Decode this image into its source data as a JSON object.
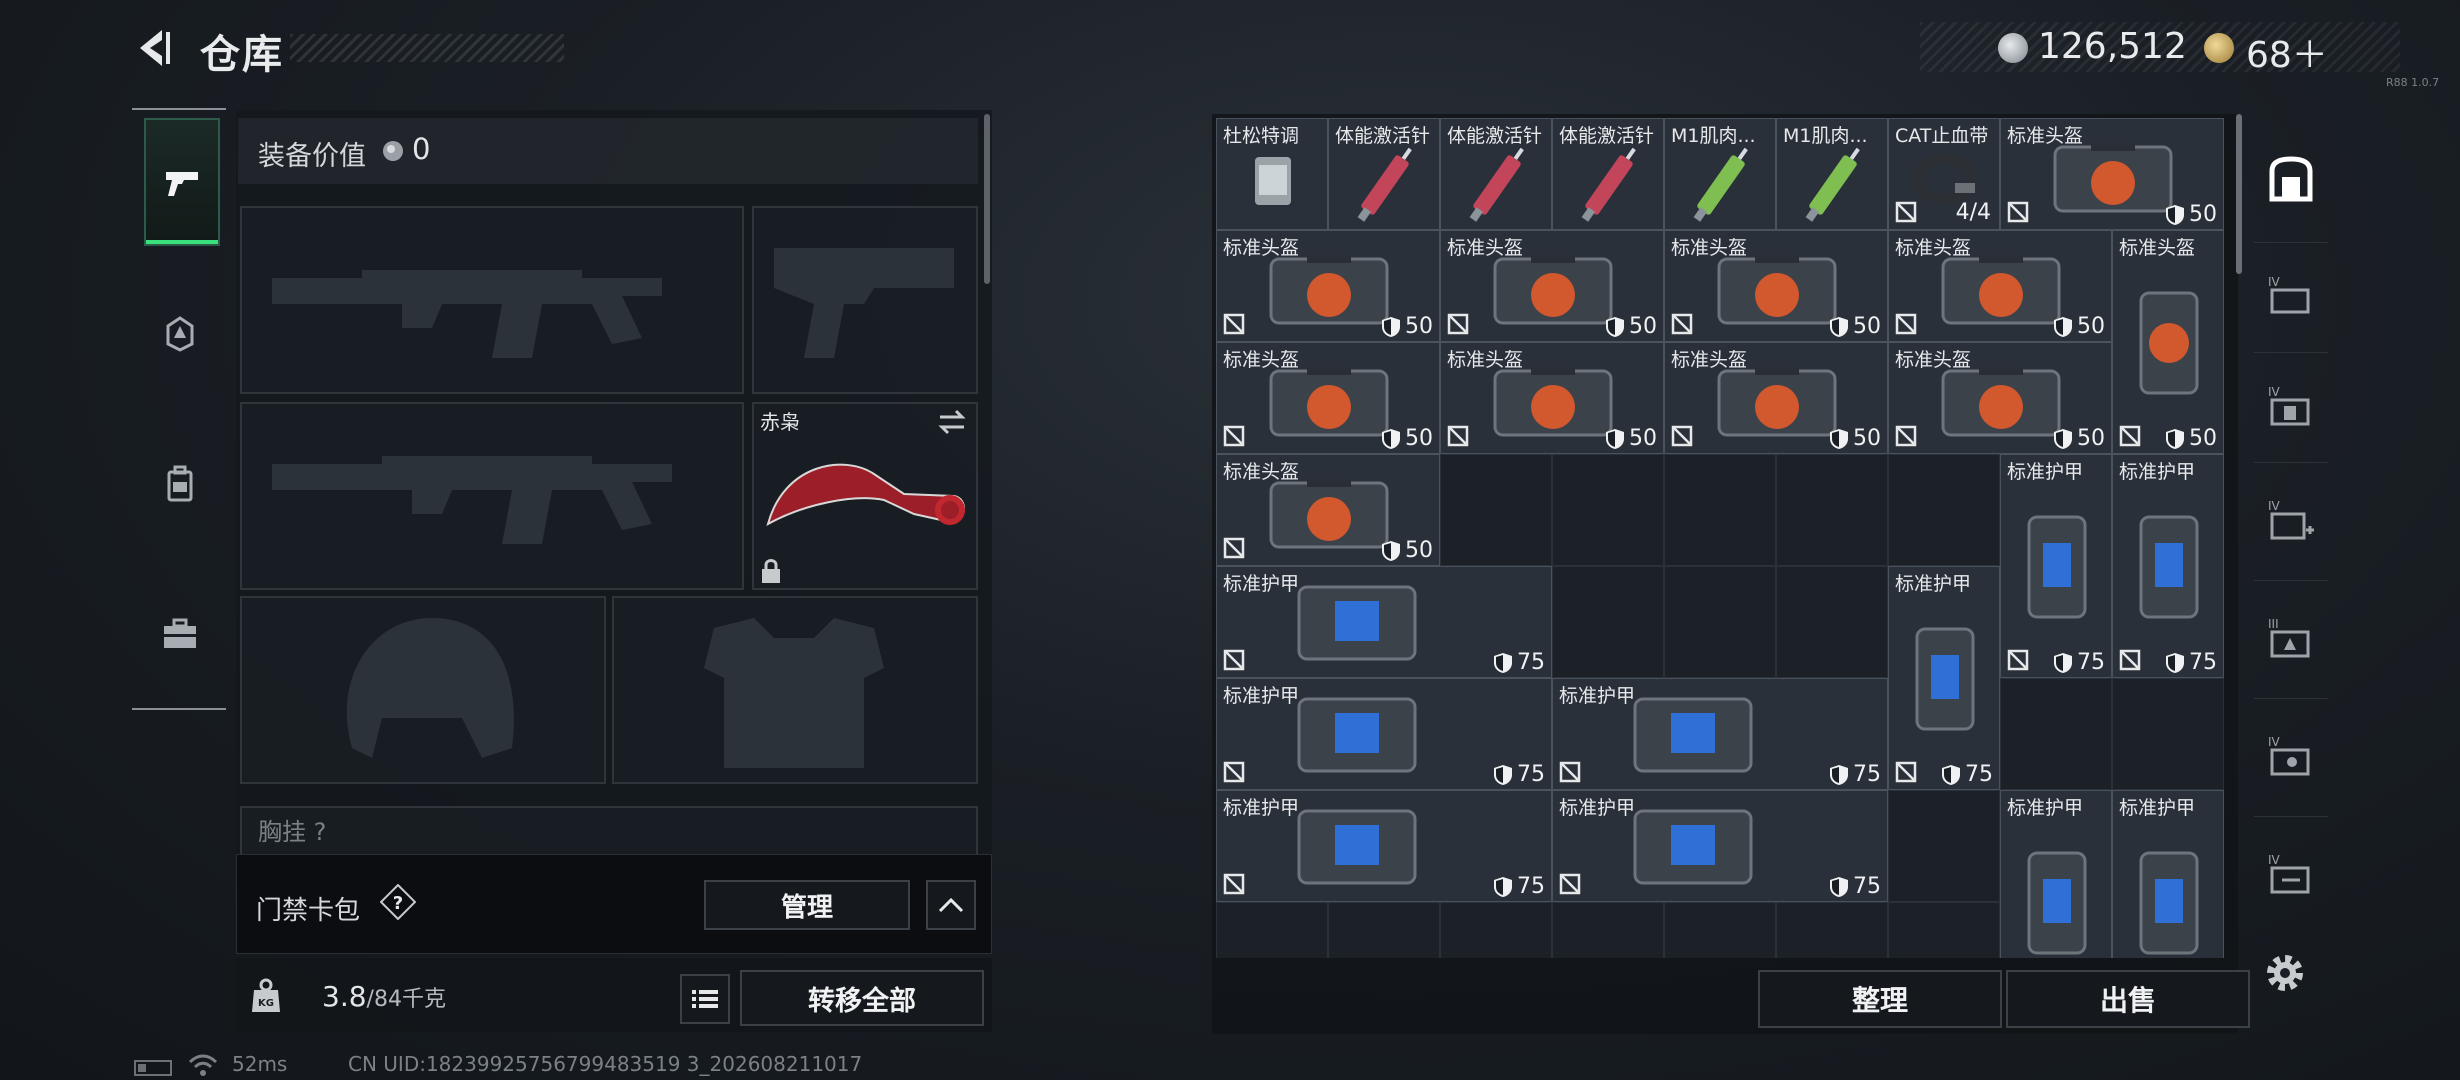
{
  "header": {
    "title": "仓库",
    "money": "126,512",
    "gold": "68＋",
    "version": "R88 1.0.7"
  },
  "equipment": {
    "value_label": "装备价值",
    "value": "0",
    "melee_name": "赤枭",
    "chest_label": "胸挂 ?"
  },
  "keycard": {
    "label": "门禁卡包",
    "help": "?",
    "manage": "管理"
  },
  "weight": {
    "current": "3.8",
    "max": "/84千克",
    "transfer_all": "转移全部"
  },
  "status": {
    "ping": "52ms",
    "uid": "CN UID:18239925756799483519 3_202608211017"
  },
  "warehouse": {
    "items": [
      {
        "name": "杜松特调",
        "type": "drink"
      },
      {
        "name": "体能激活针",
        "type": "syringe-red"
      },
      {
        "name": "体能激活针",
        "type": "syringe-red"
      },
      {
        "name": "体能激活针",
        "type": "syringe-red"
      },
      {
        "name": "M1肌肉...",
        "type": "syringe-green"
      },
      {
        "name": "M1肌肉...",
        "type": "syringe-green"
      },
      {
        "name": "CAT止血带",
        "type": "tourniquet",
        "qty": "4/4"
      },
      {
        "name": "标准头盔",
        "type": "helmet",
        "durability": "50"
      },
      {
        "name": "标准护甲",
        "type": "armor",
        "durability": "75"
      }
    ],
    "sort": "整理",
    "sell": "出售"
  },
  "colors": {
    "accent_green": "#3ae07b",
    "helmet_orange": "#d2582e",
    "armor_blue": "#2f6fd6"
  }
}
